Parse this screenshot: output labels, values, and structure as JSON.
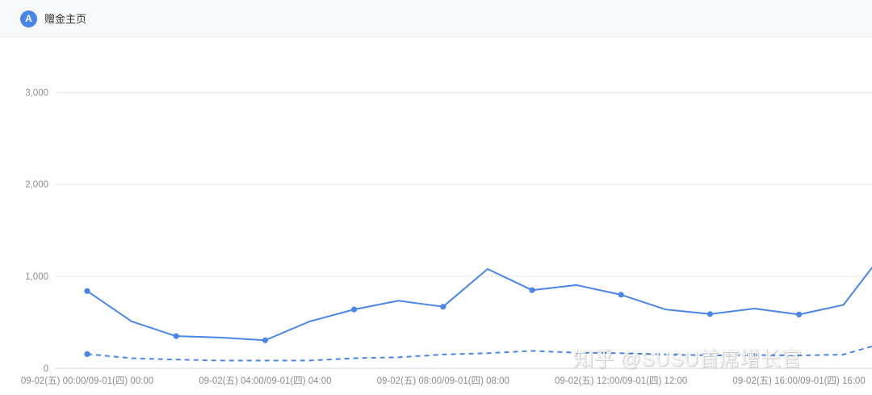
{
  "header": {
    "badge": "A",
    "title": "赠金主页"
  },
  "watermark": "知乎 @SUSU首席增长官",
  "colors": {
    "series": "#4a86e8",
    "grid": "#e6e6e6",
    "axis_text": "#8c8c8c"
  },
  "chart_data": {
    "type": "line",
    "y_ticks": [
      "0",
      "1,000",
      "2,000",
      "3,000"
    ],
    "ylim": [
      0,
      3600
    ],
    "x_tick_labels": [
      "09-02(五) 00:00/09-01(四) 00:00",
      "09-02(五) 04:00/09-01(四) 04:00",
      "09-02(五) 08:00/09-01(四) 08:00",
      "09-02(五) 12:00/09-01(四) 12:00",
      "09-02(五) 16:00/09-01(四) 16:00"
    ],
    "x": [
      0,
      1,
      2,
      3,
      4,
      5,
      6,
      7,
      8,
      9,
      10,
      11,
      12,
      13,
      14,
      15,
      16,
      17,
      18
    ],
    "grid": true,
    "series": [
      {
        "style": "solid",
        "markers": true,
        "values": [
          840,
          510,
          350,
          335,
          305,
          510,
          640,
          735,
          670,
          1080,
          850,
          905,
          800,
          640,
          590,
          650,
          585,
          690,
          1320
        ]
      },
      {
        "style": "dashed",
        "markers": true,
        "values": [
          155,
          110,
          95,
          85,
          85,
          85,
          110,
          120,
          150,
          165,
          190,
          170,
          165,
          150,
          140,
          145,
          140,
          150,
          290
        ]
      }
    ]
  }
}
